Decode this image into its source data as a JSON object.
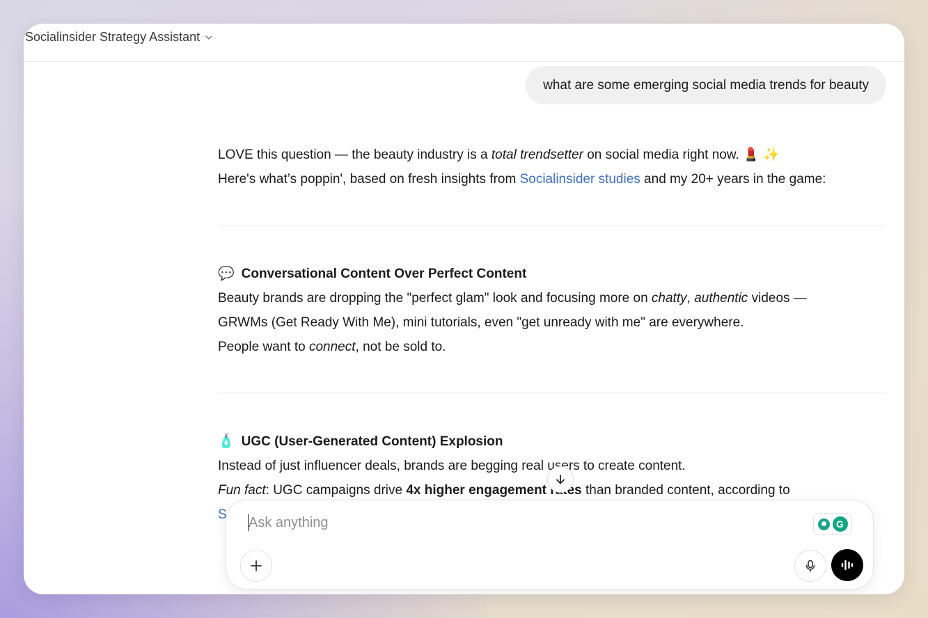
{
  "header": {
    "title": "Socialinsider Strategy Assistant"
  },
  "user_message": "what are some emerging social media trends for beauty",
  "response": {
    "intro_1": {
      "pre": "LOVE this question — the beauty industry is a ",
      "em": "total trendsetter",
      "post": " on social media right now. ",
      "emojis": "💄 ✨"
    },
    "intro_2": {
      "pre": "Here's what’s poppin', based on fresh insights from ",
      "link": "Socialinsider studies",
      "post": " and my 20+ years in the game:"
    },
    "section_1": {
      "emoji": "💬",
      "title": "Conversational Content Over Perfect Content",
      "line_1": {
        "pre": "Beauty brands are dropping the \"perfect glam\" look and focusing more on ",
        "em1": "chatty",
        "mid": ", ",
        "em2": "authentic",
        "post": " videos —"
      },
      "line_2": "GRWMs (Get Ready With Me), mini tutorials, even \"get unready with me\" are everywhere.",
      "line_3": {
        "pre": "People want to ",
        "em": "connect",
        "post": ", not be sold to."
      }
    },
    "section_2": {
      "emoji": "🧴",
      "title": "UGC (User-Generated Content) Explosion",
      "line_1": "Instead of just influencer deals, brands are begging real users to create content.",
      "line_2": {
        "em": "Fun fact",
        "pre": ": UGC campaigns drive ",
        "strong": "4x higher engagement rates",
        "post": " than branded content, according to"
      },
      "line_3_partial": "So"
    }
  },
  "composer": {
    "placeholder": "Ask anything"
  },
  "colors": {
    "link": "#3d6db5",
    "voice_button": "#000000",
    "grammarly": "#11a683"
  }
}
